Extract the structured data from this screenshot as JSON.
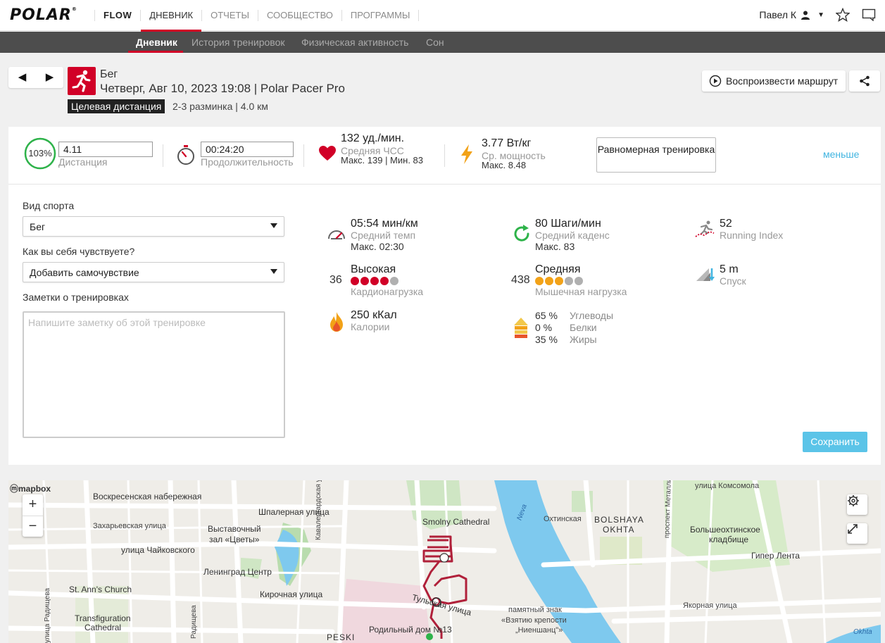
{
  "header": {
    "brand": "POLAR",
    "nav": [
      "FLOW",
      "ДНЕВНИК",
      "ОТЧЕТЫ",
      "СООБЩЕСТВО",
      "ПРОГРАММЫ"
    ],
    "user_name": "Павел К"
  },
  "subnav": [
    "Дневник",
    "История тренировок",
    "Физическая активность",
    "Сон"
  ],
  "session": {
    "sport": "Бег",
    "datetime": "Четверг, Авг 10, 2023 19:08 | Polar Pacer Pro",
    "target_badge": "Целевая дистанция",
    "target_info": "2-3 разминка  | 4.0 км",
    "replay_label": "Воспроизвести маршрут"
  },
  "summary": {
    "percent": "103%",
    "percent_value": 1.03,
    "distance_value": "4.11",
    "distance_label": "Дистанция",
    "duration_value": "00:24:20",
    "duration_label": "Продолжительность",
    "hr_value": "132 уд./мин.",
    "hr_label": "Средняя ЧСС",
    "hr_minmax": "Макс. 139  |  Мин. 83",
    "power_value": "3.77 Вт/кг",
    "power_label": "Ср. мощность",
    "power_max": "Макс. 8.48",
    "training_type": "Равномерная тренировка",
    "less_link": "меньше"
  },
  "form": {
    "sport_label": "Вид спорта",
    "sport_value": "Бег",
    "feeling_label": "Как вы себя чувствуете?",
    "feeling_value": "Добавить самочувствие",
    "notes_label": "Заметки о тренировках",
    "notes_placeholder": "Напишите заметку об этой тренировке",
    "save_label": "Сохранить"
  },
  "metrics": {
    "pace_value": "05:54 мин/км",
    "pace_label": "Средний темп",
    "pace_max": "Макс. 02:30",
    "cadence_value": "80 Шаги/мин",
    "cadence_label": "Средний каденс",
    "cadence_max": "Макс. 83",
    "ri_value": "52",
    "ri_label": "Running Index",
    "cardio_num": "36",
    "cardio_value": "Высокая",
    "cardio_label": "Кардионагрузка",
    "cardio_dots_filled": 4,
    "muscle_num": "438",
    "muscle_value": "Средняя",
    "muscle_label": "Мышечная нагрузка",
    "muscle_dots_filled": 3,
    "descent_value": "5 m",
    "descent_label": "Спуск",
    "calories_value": "250 кКал",
    "calories_label": "Калории",
    "carbs_pct": "65 %",
    "carbs_label": "Углеводы",
    "protein_pct": "0 %",
    "protein_label": "Белки",
    "fat_pct": "35 %",
    "fat_label": "Жиры"
  },
  "map": {
    "attribution": "mapbox",
    "labels": [
      "Воскресенская набережная",
      "Шпалерная улица",
      "Захарьевская улица",
      "Выставочный",
      "зал «Цветы»",
      "улица Чайковского",
      "Ленинград Центр",
      "St. Ann's Church",
      "Кирочная улица",
      "Transfiguration",
      "Cathedral",
      "Smolny Cathedral",
      "Кавалергардская улица",
      "Тульская улица",
      "Родильный дом №13",
      "PESKI",
      "Neva",
      "Охтинская",
      "BOLSHAYA",
      "OKHTA",
      "проспект Металлистов",
      "улица Комсомола",
      "Большеохтинское",
      "кладбище",
      "Гипер Лента",
      "памятный знак",
      "«Взятию крепости",
      "„Ниеншанц\"»",
      "Якорная улица",
      "Okhta",
      "Радищева",
      "улица Радищева"
    ]
  },
  "colors": {
    "brand_red": "#d10027",
    "accent_blue": "#5bc4e8",
    "route": "#b0203a"
  }
}
